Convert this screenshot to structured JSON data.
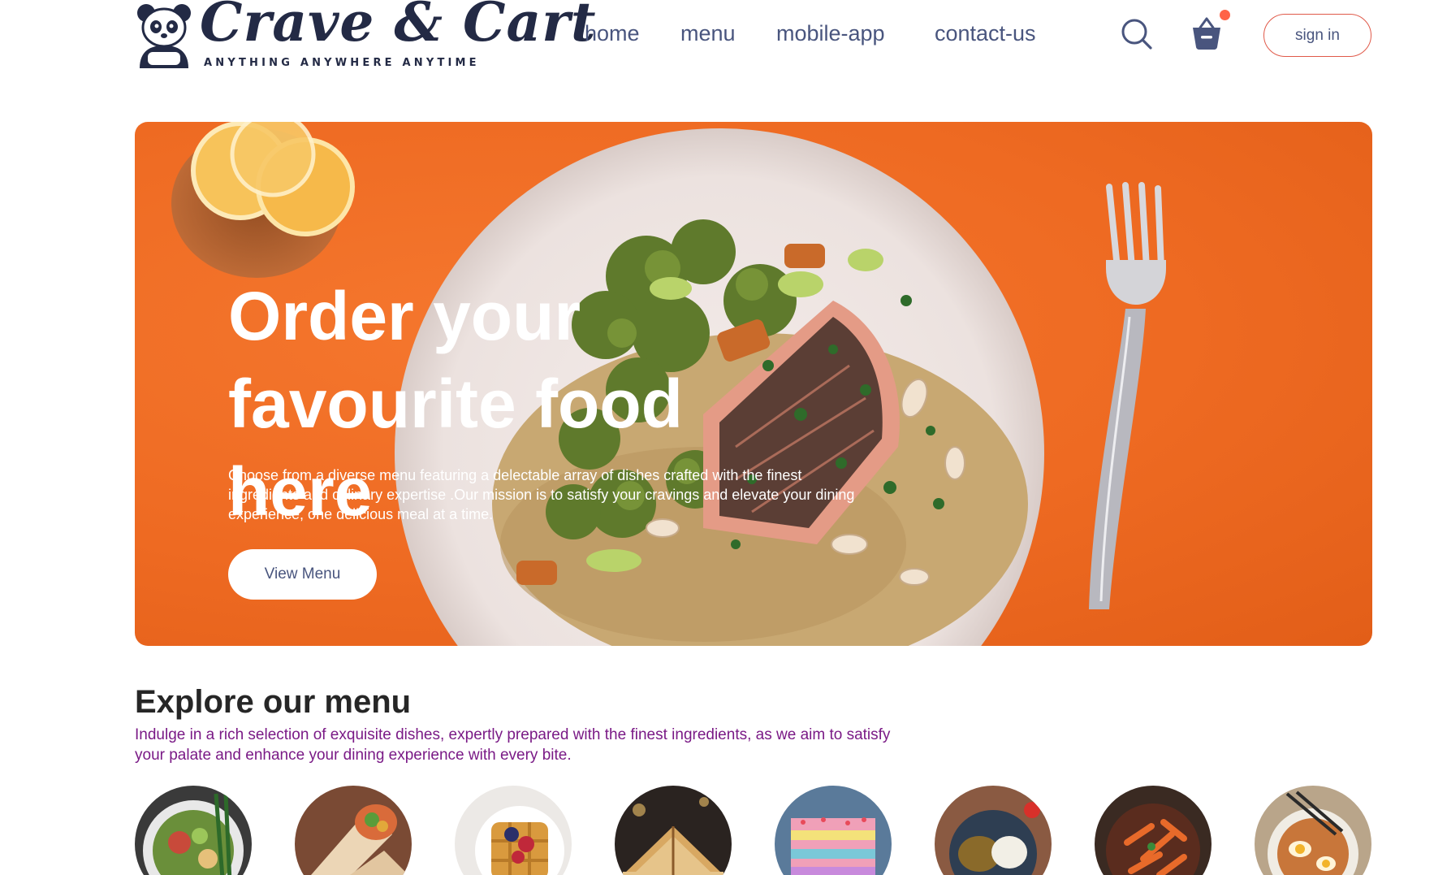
{
  "brand": {
    "name": "Crave & Cart",
    "tagline": "ANYTHING  ANYWHERE ANYTIME"
  },
  "nav": {
    "links": [
      "home",
      "menu",
      "mobile-app",
      "contact-us"
    ],
    "sign_in_label": "sign in",
    "icons": [
      "search-icon",
      "basket-icon"
    ],
    "cart_has_items": true
  },
  "hero": {
    "title_line1": "Order your",
    "title_line2": "favourite food here",
    "description": "Choose from a diverse menu featuring a delectable array of dishes crafted with the finest ingredients and culinary expertise .Our mission is to satisfy your cravings and elevate your dining experience, one delicious meal at a time.",
    "button_label": "View Menu"
  },
  "explore": {
    "title": "Explore our menu",
    "text": "Indulge in a rich selection of exquisite dishes, expertly prepared with the finest ingredients, as we aim to satisfy your palate and enhance your dining experience with every bite.",
    "items": [
      "salad-bowl",
      "wrap-rolls",
      "waffle-dessert",
      "sandwich",
      "cake-slice",
      "pure-veg-plate",
      "pasta",
      "noodles-bowl"
    ]
  },
  "colors": {
    "accent": "#ff6347",
    "hero_orange": "#ee6a22",
    "text": "#49557e",
    "explore_text": "#7a1a86",
    "dark": "#232a45"
  }
}
